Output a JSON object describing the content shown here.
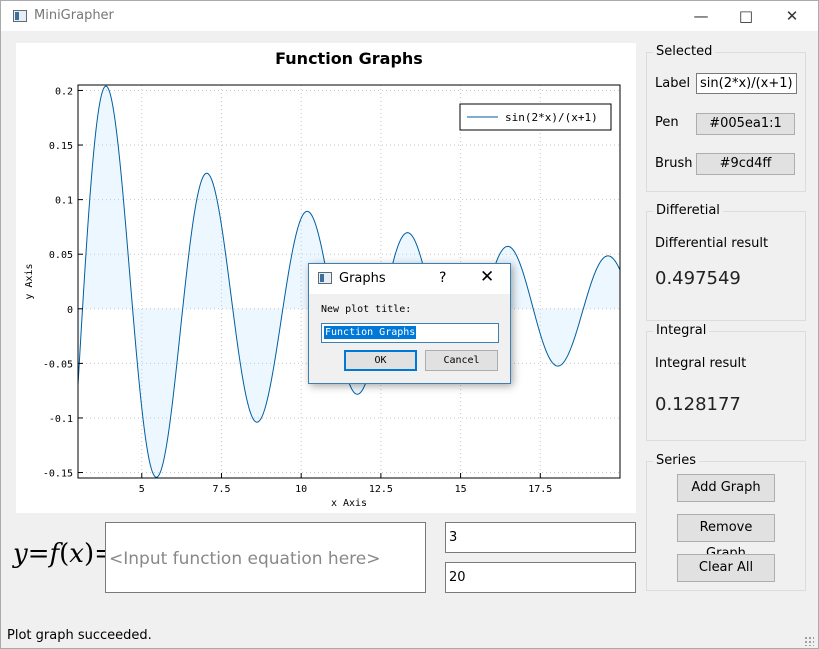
{
  "window": {
    "title": "MiniGrapher",
    "minimize_icon": "minimize-icon",
    "maximize_icon": "maximize-icon",
    "close_icon": "close-icon"
  },
  "chart_data": {
    "type": "area",
    "title": "Function Graphs",
    "xlabel": "x Axis",
    "ylabel": "y Axis",
    "xlim": [
      3,
      20
    ],
    "ylim": [
      -0.155,
      0.205
    ],
    "x_ticks": [
      "5",
      "7.5",
      "10",
      "12.5",
      "15",
      "17.5"
    ],
    "x_tick_values": [
      5,
      7.5,
      10,
      12.5,
      15,
      17.5
    ],
    "y_ticks": [
      "0.2",
      "0.15",
      "0.1",
      "0.05",
      "0",
      "-0.05",
      "-0.1",
      "-0.15"
    ],
    "y_tick_values": [
      0.2,
      0.15,
      0.1,
      0.05,
      0,
      -0.05,
      -0.1,
      -0.15
    ],
    "grid": true,
    "legend_position": "top-right",
    "series": [
      {
        "name": "sin(2*x)/(x+1)",
        "function": "sin(2*x)/(x+1)",
        "x": [
          3,
          3.92,
          5.5,
          7.06,
          8.63,
          10.2,
          11.78,
          13.35,
          14.92,
          16.49,
          18.07,
          19.64,
          20
        ],
        "y": [
          -0.07,
          0.2,
          -0.15,
          0.123,
          -0.103,
          0.088,
          -0.078,
          0.069,
          -0.062,
          0.057,
          -0.052,
          0.048,
          0.037
        ],
        "pen": "#005ea1",
        "brush": "#9cd4ff"
      }
    ]
  },
  "selected": {
    "title": "Selected",
    "label_caption": "Label",
    "label_value": "sin(2*x)/(x+1)",
    "pen_caption": "Pen",
    "pen_value": "#005ea1:1",
    "brush_caption": "Brush",
    "brush_value": "#9cd4ff"
  },
  "differential": {
    "title": "Differetial",
    "caption": "Differential result",
    "value": "0.497549"
  },
  "integral": {
    "title": "Integral",
    "caption": "Integral result",
    "value": "0.128177"
  },
  "series_group": {
    "title": "Series",
    "add_label": "Add Graph",
    "remove_label": "Remove Graph",
    "clear_label": "Clear All"
  },
  "function_input": {
    "placeholder": "<Input function equation here>",
    "range_start": "3",
    "range_end": "20"
  },
  "equation_label": {
    "y": "y",
    "eq1": "=",
    "f": "f",
    "open": "(",
    "x": "x",
    "close": ")",
    "eq2": "="
  },
  "status": {
    "text": "Plot graph succeeded."
  },
  "dialog": {
    "title": "Graphs",
    "help": "?",
    "close": "✕",
    "prompt": "New plot title:",
    "value": "Function Graphs",
    "ok_label": "OK",
    "cancel_label": "Cancel"
  }
}
